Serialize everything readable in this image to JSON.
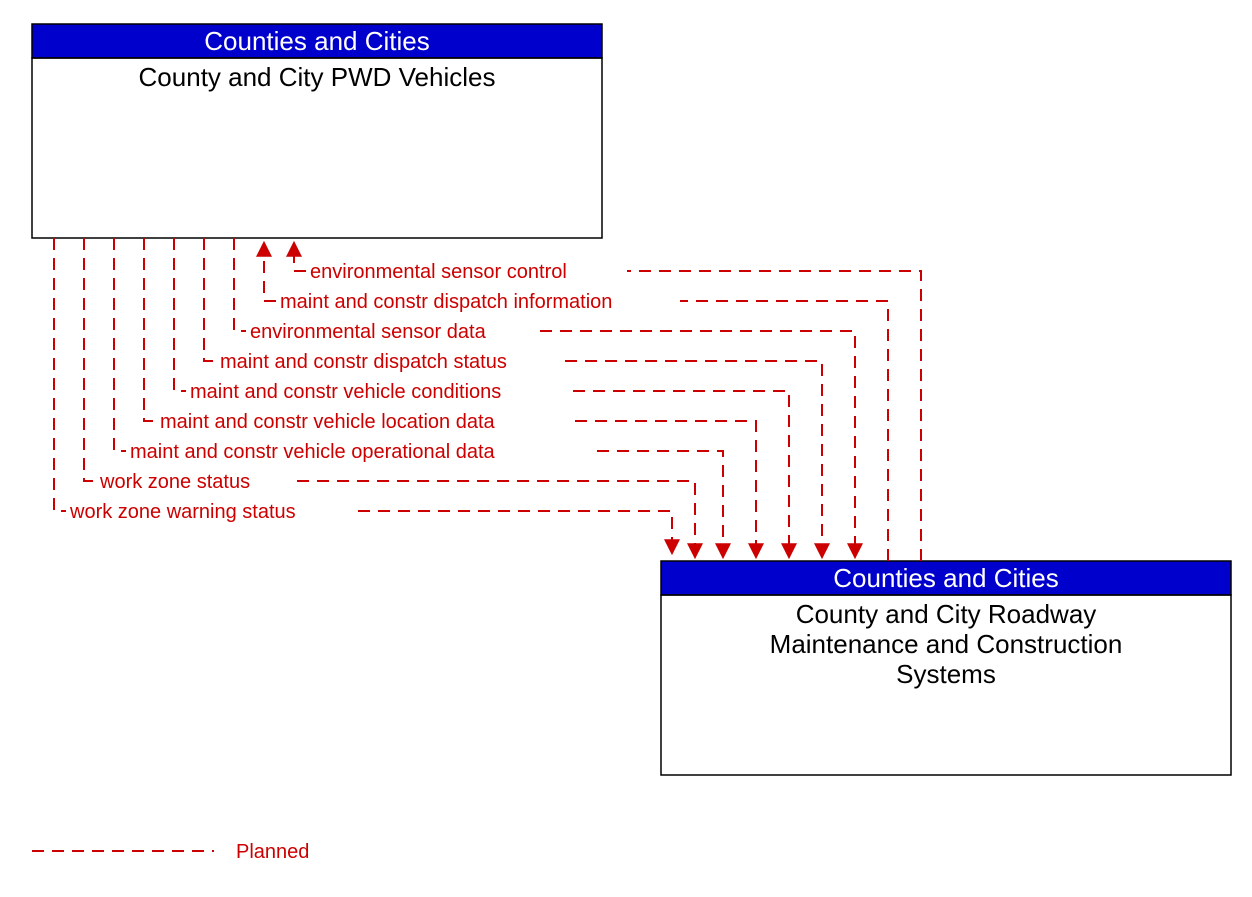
{
  "colors": {
    "header_bg": "#0000cc",
    "header_text": "#ffffff",
    "flow": "#cc0000",
    "body_text": "#000000"
  },
  "boxes": {
    "top": {
      "header": "Counties and Cities",
      "body": "County and City PWD Vehicles"
    },
    "bottom": {
      "header": "Counties and Cities",
      "body_line1": "County and City Roadway",
      "body_line2": "Maintenance and Construction",
      "body_line3": "Systems"
    }
  },
  "flows_to_top": [
    {
      "label": "environmental sensor control"
    },
    {
      "label": "maint and constr dispatch information"
    }
  ],
  "flows_to_bottom": [
    {
      "label": "environmental sensor data"
    },
    {
      "label": "maint and constr dispatch status"
    },
    {
      "label": "maint and constr vehicle conditions"
    },
    {
      "label": "maint and constr vehicle location data"
    },
    {
      "label": "maint and constr vehicle operational data"
    },
    {
      "label": "work zone status"
    },
    {
      "label": "work zone warning status"
    }
  ],
  "legend": {
    "label": "Planned"
  }
}
